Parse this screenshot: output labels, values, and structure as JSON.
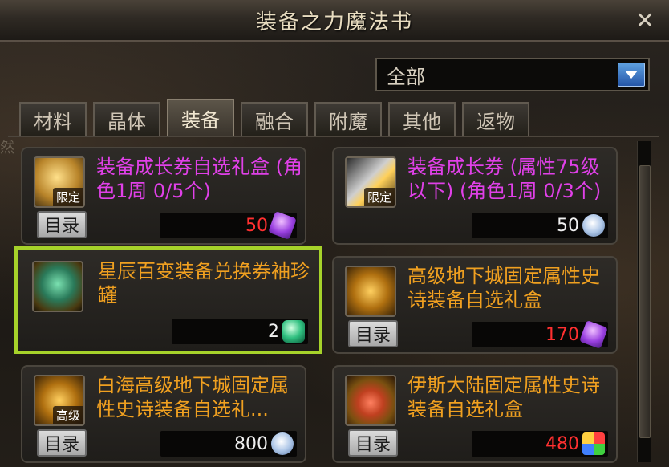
{
  "window": {
    "title": "装备之力魔法书",
    "close_glyph": "✕"
  },
  "filter": {
    "selected": "全部"
  },
  "tabs": [
    {
      "label": "材料",
      "active": false
    },
    {
      "label": "晶体",
      "active": false
    },
    {
      "label": "装备",
      "active": true
    },
    {
      "label": "融合",
      "active": false
    },
    {
      "label": "附魔",
      "active": false
    },
    {
      "label": "其他",
      "active": false
    },
    {
      "label": "返物",
      "active": false
    }
  ],
  "items": [
    {
      "name": "装备成长券自选礼盒 (角色1周 0/5个)",
      "name_color": "purple",
      "icon": "gold-box-icon",
      "icon_badge": "限定",
      "catalog_label": "目录",
      "price": "50",
      "price_color": "red",
      "currency_icon": "purple-gem-icon",
      "selected": false
    },
    {
      "name": "装备成长券 (属性75级以下) (角色1周 0/3个)",
      "name_color": "purple",
      "icon": "pencil-icon",
      "icon_badge": "限定",
      "catalog_label": "",
      "price": "50",
      "price_color": "white",
      "currency_icon": "white-gem-icon",
      "selected": false
    },
    {
      "name": "星辰百变装备兑换券袖珍罐",
      "name_color": "orange",
      "icon": "green-chest-icon",
      "icon_badge": "",
      "catalog_label": "",
      "price": "2",
      "price_color": "white",
      "currency_icon": "green-gem-icon",
      "selected": true
    },
    {
      "name": "高级地下城固定属性史诗装备自选礼盒",
      "name_color": "orange",
      "icon": "gold-chest-icon",
      "icon_badge": "",
      "catalog_label": "目录",
      "price": "170",
      "price_color": "red",
      "currency_icon": "purple-gem-icon",
      "selected": false
    },
    {
      "name": "白海高级地下城固定属性史诗装备自选礼...",
      "name_color": "orange",
      "icon": "gold-chest-icon",
      "icon_badge": "高级",
      "catalog_label": "目录",
      "price": "800",
      "price_color": "white",
      "currency_icon": "white-gem-icon",
      "selected": false
    },
    {
      "name": "伊斯大陆固定属性史诗装备自选礼盒",
      "name_color": "orange",
      "icon": "red-chest-icon",
      "icon_badge": "",
      "catalog_label": "目录",
      "price": "480",
      "price_color": "red",
      "currency_icon": "multi-gem-icon",
      "selected": false
    }
  ],
  "side_text": "然"
}
